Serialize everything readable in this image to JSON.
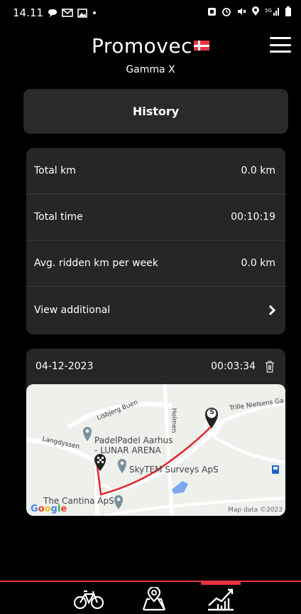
{
  "status_bar": {
    "time": "14.11",
    "left_icons": [
      "chat-icon",
      "mail-icon",
      "image-icon",
      "dot-icon"
    ],
    "right_icons": [
      "nfc-icon",
      "alarm-icon",
      "mute-icon",
      "location-icon",
      "signal-icon",
      "battery-icon"
    ]
  },
  "header": {
    "brand": "Promovec",
    "device_name": "Gamma X"
  },
  "history": {
    "title": "History"
  },
  "stats": [
    {
      "label": "Total km",
      "value": "0.0 km"
    },
    {
      "label": "Total time",
      "value": "00:10:19"
    },
    {
      "label": "Avg. ridden km per week",
      "value": "0.0 km"
    },
    {
      "label": "View additional",
      "value": ""
    }
  ],
  "ride": {
    "date": "04-12-2023",
    "duration": "00:03:34",
    "map": {
      "labels": {
        "lisbjerg": "Lisbjerg Buen",
        "holmen": "Holmen",
        "trille": "Trille Nielsens Ga",
        "langdyssen": "Langdyssen",
        "padel_1": "PadelPadel Aarhus",
        "padel_2": "- LUNAR ARENA",
        "skytem": "SkyTEM Surveys ApS",
        "cantina": "The Cantina ApS"
      },
      "start_marker": "S",
      "google": "Google",
      "attribution": "Map data ©2023"
    }
  },
  "nav": {
    "tabs": [
      "bike-icon",
      "map-route-icon",
      "stats-chart-icon"
    ],
    "active": "stats-chart-icon",
    "accent": "#e63340"
  }
}
